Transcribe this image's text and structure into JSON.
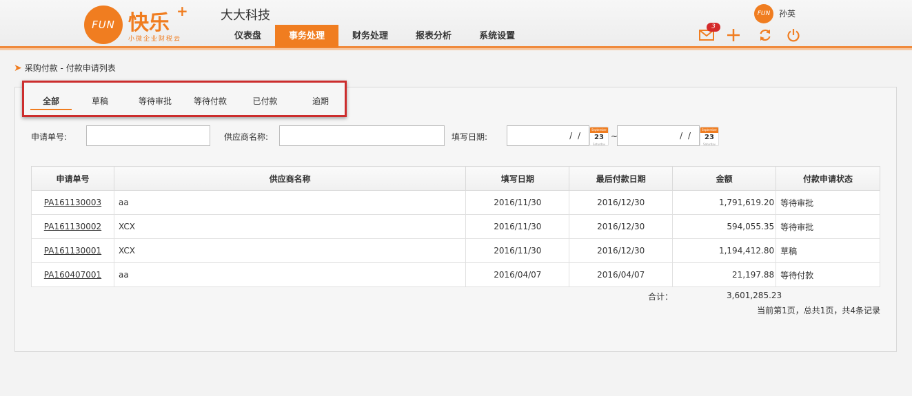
{
  "brand": {
    "logo_text": "FUN",
    "name": "快乐",
    "plus": "+",
    "subtitle": "小微企业财税云",
    "company": "大大科技"
  },
  "nav": [
    {
      "label": "仪表盘"
    },
    {
      "label": "事务处理",
      "active": true
    },
    {
      "label": "财务处理"
    },
    {
      "label": "报表分析"
    },
    {
      "label": "系统设置"
    }
  ],
  "user": {
    "avatar_text": "FUN",
    "name": "孙英",
    "mail_count": "3"
  },
  "icons": [
    "mail-icon",
    "plus-icon",
    "refresh-icon",
    "power-icon",
    "calendar-icon",
    "breadcrumb-arrow-icon"
  ],
  "breadcrumb": "采购付款 - 付款申请列表",
  "tabs": [
    "全部",
    "草稿",
    "等待审批",
    "等待付款",
    "已付款",
    "逾期"
  ],
  "filters": {
    "order_no_label": "申请单号:",
    "supplier_label": "供应商名称:",
    "date_label": "填写日期:",
    "date_from": "/ /",
    "date_to": "/ /",
    "range_sep": "~",
    "calendar_month": "September",
    "calendar_day": "23",
    "calendar_weekday": "Saturday"
  },
  "table": {
    "headers": [
      "申请单号",
      "供应商名称",
      "填写日期",
      "最后付款日期",
      "金额",
      "付款申请状态"
    ],
    "rows": [
      [
        "PA161130003",
        "aa",
        "2016/11/30",
        "2016/12/30",
        "1,791,619.20",
        "等待审批"
      ],
      [
        "PA161130002",
        "XCX",
        "2016/11/30",
        "2016/12/30",
        "594,055.35",
        "等待审批"
      ],
      [
        "PA161130001",
        "XCX",
        "2016/11/30",
        "2016/12/30",
        "1,194,412.80",
        "草稿"
      ],
      [
        "PA160407001",
        "aa",
        "2016/04/07",
        "2016/04/07",
        "21,197.88",
        "等待付款"
      ]
    ]
  },
  "total": {
    "label": "合计：",
    "value": "3,601,285.23"
  },
  "pager": "当前第1页，总共1页，共4条记录",
  "colors": {
    "accent": "#f07d20",
    "highlight": "#cc2d2d",
    "badge": "#d42a2a"
  }
}
